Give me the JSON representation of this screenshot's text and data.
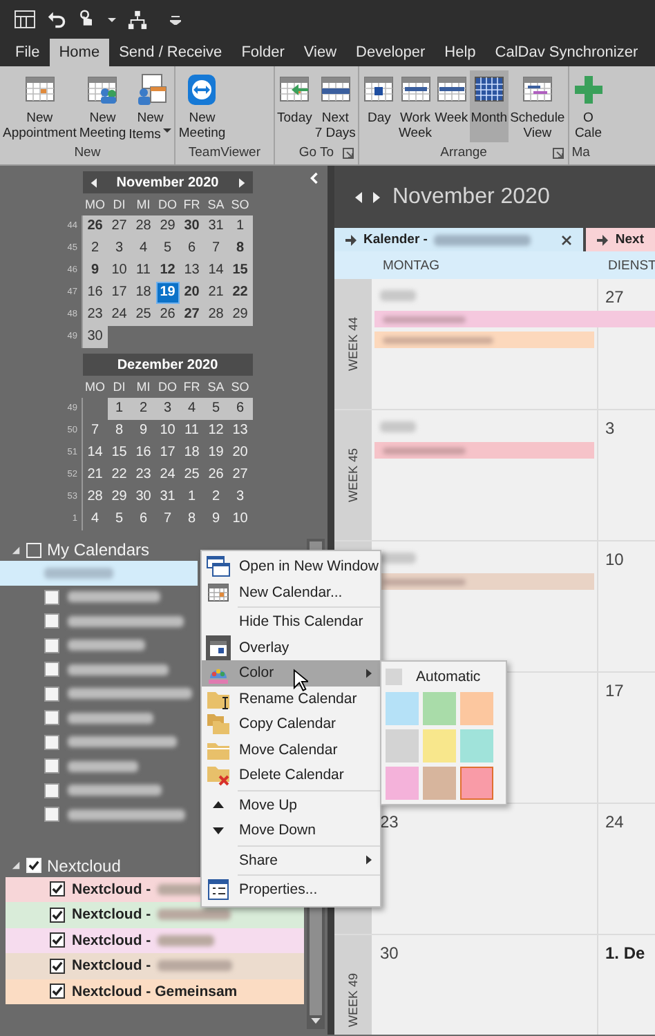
{
  "tabs": [
    {
      "label": "File",
      "selected": false
    },
    {
      "label": "Home",
      "selected": true
    },
    {
      "label": "Send / Receive",
      "selected": false
    },
    {
      "label": "Folder",
      "selected": false
    },
    {
      "label": "View",
      "selected": false
    },
    {
      "label": "Developer",
      "selected": false
    },
    {
      "label": "Help",
      "selected": false
    },
    {
      "label": "CalDav Synchronizer",
      "selected": false
    }
  ],
  "ribbon": {
    "groups": [
      {
        "label": "New",
        "buttons": [
          {
            "label": "New\nAppointment",
            "selected": false,
            "dropdown": false
          },
          {
            "label": "New\nMeeting",
            "selected": false,
            "dropdown": false
          },
          {
            "label": "New\nItems",
            "selected": false,
            "dropdown": true
          }
        ]
      },
      {
        "label": "TeamViewer",
        "buttons": [
          {
            "label": "New\nMeeting",
            "selected": false,
            "dropdown": false
          }
        ]
      },
      {
        "label": "Go To",
        "launcher": true,
        "buttons": [
          {
            "label": "Today",
            "selected": false,
            "dropdown": false
          },
          {
            "label": "Next\n7 Days",
            "selected": false,
            "dropdown": false
          }
        ]
      },
      {
        "label": "Arrange",
        "launcher": true,
        "buttons": [
          {
            "label": "Day",
            "selected": false,
            "dropdown": false
          },
          {
            "label": "Work\nWeek",
            "selected": false,
            "dropdown": false
          },
          {
            "label": "Week",
            "selected": false,
            "dropdown": false
          },
          {
            "label": "Month",
            "selected": true,
            "dropdown": false
          },
          {
            "label": "Schedule\nView",
            "selected": false,
            "dropdown": false
          }
        ]
      },
      {
        "label": "Ma",
        "buttons": [
          {
            "label": "O\nCale",
            "selected": false,
            "dropdown": false
          }
        ]
      }
    ]
  },
  "navigator": [
    {
      "title": "November 2020",
      "arrows": true,
      "weekdays": [
        "MO",
        "DI",
        "MI",
        "DO",
        "FR",
        "SA",
        "SO"
      ],
      "weeks": [
        {
          "number": "44",
          "days": [
            {
              "text": "26",
              "bold": true,
              "shaded": true,
              "selected": false
            },
            {
              "text": "27",
              "bold": false,
              "shaded": true,
              "selected": false
            },
            {
              "text": "28",
              "bold": false,
              "shaded": true,
              "selected": false
            },
            {
              "text": "29",
              "bold": false,
              "shaded": true,
              "selected": false
            },
            {
              "text": "30",
              "bold": true,
              "shaded": true,
              "selected": false
            },
            {
              "text": "31",
              "bold": false,
              "shaded": true,
              "selected": false
            },
            {
              "text": "1",
              "bold": false,
              "shaded": true,
              "selected": false
            }
          ]
        },
        {
          "number": "45",
          "days": [
            {
              "text": "2",
              "bold": false,
              "shaded": true,
              "selected": false
            },
            {
              "text": "3",
              "bold": false,
              "shaded": true,
              "selected": false
            },
            {
              "text": "4",
              "bold": false,
              "shaded": true,
              "selected": false
            },
            {
              "text": "5",
              "bold": false,
              "shaded": true,
              "selected": false
            },
            {
              "text": "6",
              "bold": false,
              "shaded": true,
              "selected": false
            },
            {
              "text": "7",
              "bold": false,
              "shaded": true,
              "selected": false
            },
            {
              "text": "8",
              "bold": true,
              "shaded": true,
              "selected": false
            }
          ]
        },
        {
          "number": "46",
          "days": [
            {
              "text": "9",
              "bold": true,
              "shaded": true,
              "selected": false
            },
            {
              "text": "10",
              "bold": false,
              "shaded": true,
              "selected": false
            },
            {
              "text": "11",
              "bold": false,
              "shaded": true,
              "selected": false
            },
            {
              "text": "12",
              "bold": true,
              "shaded": true,
              "selected": false
            },
            {
              "text": "13",
              "bold": false,
              "shaded": true,
              "selected": false
            },
            {
              "text": "14",
              "bold": false,
              "shaded": true,
              "selected": false
            },
            {
              "text": "15",
              "bold": true,
              "shaded": true,
              "selected": false
            }
          ]
        },
        {
          "number": "47",
          "days": [
            {
              "text": "16",
              "bold": false,
              "shaded": true,
              "selected": false
            },
            {
              "text": "17",
              "bold": false,
              "shaded": true,
              "selected": false
            },
            {
              "text": "18",
              "bold": false,
              "shaded": true,
              "selected": false
            },
            {
              "text": "19",
              "bold": true,
              "shaded": true,
              "selected": true
            },
            {
              "text": "20",
              "bold": true,
              "shaded": true,
              "selected": false
            },
            {
              "text": "21",
              "bold": false,
              "shaded": true,
              "selected": false
            },
            {
              "text": "22",
              "bold": true,
              "shaded": true,
              "selected": false
            }
          ]
        },
        {
          "number": "48",
          "days": [
            {
              "text": "23",
              "bold": false,
              "shaded": true,
              "selected": false
            },
            {
              "text": "24",
              "bold": false,
              "shaded": true,
              "selected": false
            },
            {
              "text": "25",
              "bold": false,
              "shaded": true,
              "selected": false
            },
            {
              "text": "26",
              "bold": false,
              "shaded": true,
              "selected": false
            },
            {
              "text": "27",
              "bold": true,
              "shaded": true,
              "selected": false
            },
            {
              "text": "28",
              "bold": false,
              "shaded": true,
              "selected": false
            },
            {
              "text": "29",
              "bold": false,
              "shaded": true,
              "selected": false
            }
          ]
        },
        {
          "number": "49",
          "days": [
            {
              "text": "30",
              "bold": false,
              "shaded": true,
              "selected": false
            }
          ]
        }
      ]
    },
    {
      "title": "Dezember 2020",
      "arrows": false,
      "weekdays": [
        "MO",
        "DI",
        "MI",
        "DO",
        "FR",
        "SA",
        "SO"
      ],
      "weeks": [
        {
          "number": "49",
          "days": [
            {
              "text": "1",
              "bold": false,
              "shaded": true,
              "selected": false
            },
            {
              "text": "2",
              "bold": false,
              "shaded": true,
              "selected": false
            },
            {
              "text": "3",
              "bold": false,
              "shaded": true,
              "selected": false
            },
            {
              "text": "4",
              "bold": false,
              "shaded": true,
              "selected": false
            },
            {
              "text": "5",
              "bold": false,
              "shaded": true,
              "selected": false
            },
            {
              "text": "6",
              "bold": false,
              "shaded": true,
              "selected": false
            }
          ]
        },
        {
          "number": "50",
          "days": [
            {
              "text": "7",
              "bold": false,
              "shaded": false,
              "selected": false
            },
            {
              "text": "8",
              "bold": false,
              "shaded": false,
              "selected": false
            },
            {
              "text": "9",
              "bold": false,
              "shaded": false,
              "selected": false
            },
            {
              "text": "10",
              "bold": false,
              "shaded": false,
              "selected": false
            },
            {
              "text": "11",
              "bold": false,
              "shaded": false,
              "selected": false
            },
            {
              "text": "12",
              "bold": false,
              "shaded": false,
              "selected": false
            },
            {
              "text": "13",
              "bold": false,
              "shaded": false,
              "selected": false
            }
          ]
        },
        {
          "number": "51",
          "days": [
            {
              "text": "14",
              "bold": false,
              "shaded": false,
              "selected": false
            },
            {
              "text": "15",
              "bold": false,
              "shaded": false,
              "selected": false
            },
            {
              "text": "16",
              "bold": false,
              "shaded": false,
              "selected": false
            },
            {
              "text": "17",
              "bold": false,
              "shaded": false,
              "selected": false
            },
            {
              "text": "18",
              "bold": false,
              "shaded": false,
              "selected": false
            },
            {
              "text": "19",
              "bold": false,
              "shaded": false,
              "selected": false
            },
            {
              "text": "20",
              "bold": false,
              "shaded": false,
              "selected": false
            }
          ]
        },
        {
          "number": "52",
          "days": [
            {
              "text": "21",
              "bold": false,
              "shaded": false,
              "selected": false
            },
            {
              "text": "22",
              "bold": false,
              "shaded": false,
              "selected": false
            },
            {
              "text": "23",
              "bold": false,
              "shaded": false,
              "selected": false
            },
            {
              "text": "24",
              "bold": false,
              "shaded": false,
              "selected": false
            },
            {
              "text": "25",
              "bold": false,
              "shaded": false,
              "selected": false
            },
            {
              "text": "26",
              "bold": false,
              "shaded": false,
              "selected": false
            },
            {
              "text": "27",
              "bold": false,
              "shaded": false,
              "selected": false
            }
          ]
        },
        {
          "number": "53",
          "days": [
            {
              "text": "28",
              "bold": false,
              "shaded": false,
              "selected": false
            },
            {
              "text": "29",
              "bold": false,
              "shaded": false,
              "selected": false
            },
            {
              "text": "30",
              "bold": false,
              "shaded": false,
              "selected": false
            },
            {
              "text": "31",
              "bold": false,
              "shaded": false,
              "selected": false
            },
            {
              "text": "1",
              "bold": false,
              "shaded": false,
              "selected": false
            },
            {
              "text": "2",
              "bold": false,
              "shaded": false,
              "selected": false
            },
            {
              "text": "3",
              "bold": false,
              "shaded": false,
              "selected": false
            }
          ]
        },
        {
          "number": "1",
          "days": [
            {
              "text": "4",
              "bold": false,
              "shaded": false,
              "selected": false
            },
            {
              "text": "5",
              "bold": false,
              "shaded": false,
              "selected": false
            },
            {
              "text": "6",
              "bold": false,
              "shaded": false,
              "selected": false
            },
            {
              "text": "7",
              "bold": false,
              "shaded": false,
              "selected": false
            },
            {
              "text": "8",
              "bold": false,
              "shaded": false,
              "selected": false
            },
            {
              "text": "9",
              "bold": false,
              "shaded": false,
              "selected": false
            },
            {
              "text": "10",
              "bold": false,
              "shaded": false,
              "selected": false
            }
          ]
        }
      ]
    }
  ],
  "calendar_groups": [
    {
      "label": "My Calendars",
      "checked": false,
      "expanded": true,
      "items": [
        {
          "selected": true
        },
        {
          "checked": false,
          "selected": false
        },
        {
          "checked": false,
          "selected": false
        },
        {
          "checked": false,
          "selected": false
        },
        {
          "checked": false,
          "selected": false
        },
        {
          "checked": false,
          "selected": false
        },
        {
          "checked": false,
          "selected": false
        },
        {
          "checked": false,
          "selected": false
        },
        {
          "checked": false,
          "selected": false
        },
        {
          "checked": false,
          "selected": false
        },
        {
          "checked": false,
          "selected": false
        }
      ]
    },
    {
      "label": "Nextcloud",
      "checked": true,
      "expanded": true,
      "items": [
        {
          "label": "Nextcloud -",
          "checked": true,
          "selected": false,
          "color": "#f7d6d8"
        },
        {
          "label": "Nextcloud -",
          "checked": true,
          "selected": false,
          "color": "#d9ecd9"
        },
        {
          "label": "Nextcloud -",
          "checked": true,
          "selected": false,
          "color": "#f6dcee"
        },
        {
          "label": "Nextcloud -",
          "checked": true,
          "selected": false,
          "color": "#ecdcce"
        },
        {
          "label": "Nextcloud - Gemeinsam",
          "checked": true,
          "selected": false,
          "color": "#fbdcc3"
        }
      ]
    }
  ],
  "calendar": {
    "title": "November 2020",
    "tabs": [
      {
        "label": "Kalender -",
        "selected": true,
        "closable": true,
        "color": "#d2eaf8"
      },
      {
        "label": "Next",
        "selected": false,
        "closable": false,
        "color": "#f9d2d6"
      }
    ],
    "day_names": [
      "MONTAG",
      "DIENST"
    ],
    "weeks": [
      {
        "label": "WEEK 44",
        "cells": [
          {
            "date_blurred": true
          },
          {
            "date": "27",
            "bold": false
          }
        ],
        "events": [
          {
            "color": "#f5c8de",
            "wide": true
          },
          {
            "color": "#fcd8bc",
            "wide": false
          }
        ]
      },
      {
        "label": "WEEK 45",
        "cells": [
          {
            "date_blurred": true
          },
          {
            "date": "3",
            "bold": false
          }
        ],
        "events": [
          {
            "color": "#f6c3c9",
            "wide": false
          }
        ]
      },
      {
        "cells": [
          {
            "date_blurred": true
          },
          {
            "date": "10",
            "bold": false
          }
        ],
        "events": [
          {
            "color": "#e9d3c5",
            "wide": false
          }
        ]
      },
      {
        "cells": [
          {},
          {
            "date": "17",
            "bold": false
          }
        ]
      },
      {
        "cells": [
          {
            "date": "23",
            "bold": false
          },
          {
            "date": "24",
            "bold": false
          }
        ]
      },
      {
        "label": "WEEK 49",
        "cells": [
          {
            "date": "30",
            "bold": false
          },
          {
            "date": "1. De",
            "bold": true
          }
        ]
      }
    ]
  },
  "context_menu": {
    "items": [
      {
        "kind": "item",
        "label": "Open in New Window",
        "selected": false,
        "submenu": false
      },
      {
        "kind": "item",
        "label": "New Calendar...",
        "selected": false,
        "submenu": false
      },
      {
        "kind": "separator"
      },
      {
        "kind": "item",
        "label": "Hide This Calendar",
        "selected": false,
        "submenu": false
      },
      {
        "kind": "item",
        "label": "Overlay",
        "selected": false,
        "submenu": false
      },
      {
        "kind": "item",
        "label": "Color",
        "selected": true,
        "submenu": true
      },
      {
        "kind": "item",
        "label": "Rename Calendar",
        "selected": false,
        "submenu": false
      },
      {
        "kind": "item",
        "label": "Copy Calendar",
        "selected": false,
        "submenu": false
      },
      {
        "kind": "item",
        "label": "Move Calendar",
        "selected": false,
        "submenu": false
      },
      {
        "kind": "item",
        "label": "Delete Calendar",
        "selected": false,
        "submenu": false
      },
      {
        "kind": "separator"
      },
      {
        "kind": "item",
        "label": "Move Up",
        "selected": false,
        "submenu": false
      },
      {
        "kind": "item",
        "label": "Move Down",
        "selected": false,
        "submenu": false
      },
      {
        "kind": "separator"
      },
      {
        "kind": "item",
        "label": "Share",
        "selected": false,
        "submenu": true
      },
      {
        "kind": "separator"
      },
      {
        "kind": "item",
        "label": "Properties...",
        "selected": false,
        "submenu": false
      }
    ]
  },
  "color_submenu": {
    "automatic": "Automatic",
    "swatches": [
      {
        "color": "#b5e1f7",
        "selected": false
      },
      {
        "color": "#a9dca9",
        "selected": false
      },
      {
        "color": "#fcc79f",
        "selected": false
      },
      {
        "color": "#d3d3d3",
        "selected": false
      },
      {
        "color": "#f8e78c",
        "selected": false
      },
      {
        "color": "#a0e3da",
        "selected": false
      },
      {
        "color": "#f4b2da",
        "selected": false
      },
      {
        "color": "#d7b59d",
        "selected": false
      },
      {
        "color": "#f99ba7",
        "selected": true
      }
    ]
  }
}
